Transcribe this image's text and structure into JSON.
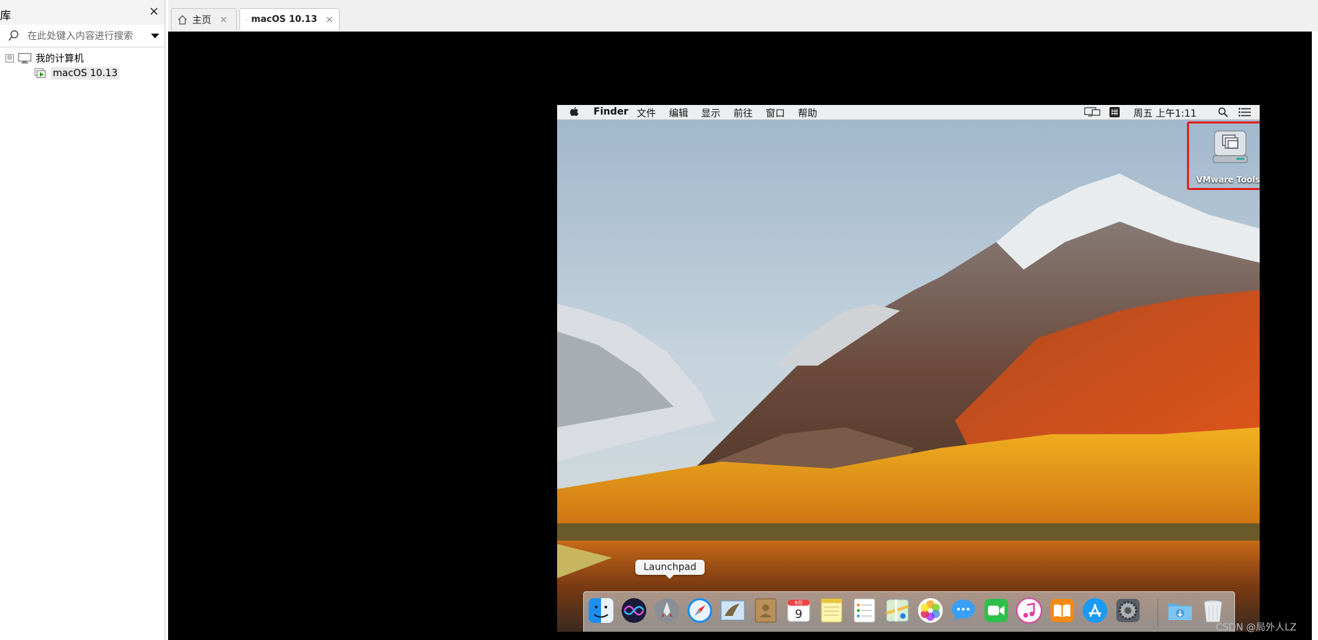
{
  "library": {
    "title": "库",
    "close_icon": "×",
    "search_placeholder": "在此处键入内容进行搜索",
    "tree": [
      {
        "label": "我的计算机",
        "toggle": "⊟"
      },
      {
        "label": "macOS 10.13"
      }
    ]
  },
  "tabs": [
    {
      "label": "主页",
      "close": "×"
    },
    {
      "label": "macOS 10.13",
      "close": "×"
    }
  ],
  "mac": {
    "menubar": {
      "items": [
        "Finder",
        "文件",
        "编辑",
        "显示",
        "前往",
        "窗口",
        "帮助"
      ],
      "clock": "周五 上午1:11"
    },
    "desktop_icon": {
      "label": "VMware Tools",
      "icon": "disk-icon"
    },
    "tooltip": "Launchpad",
    "dock_calendar_month": "6月",
    "dock_calendar_day": "9",
    "dock": [
      {
        "name": "finder-icon"
      },
      {
        "name": "siri-icon"
      },
      {
        "name": "launchpad-icon"
      },
      {
        "name": "safari-icon"
      },
      {
        "name": "mail-icon"
      },
      {
        "name": "contacts-icon"
      },
      {
        "name": "calendar-icon"
      },
      {
        "name": "notes-icon"
      },
      {
        "name": "reminders-icon"
      },
      {
        "name": "maps-icon"
      },
      {
        "name": "photos-icon"
      },
      {
        "name": "messages-icon"
      },
      {
        "name": "facetime-icon"
      },
      {
        "name": "itunes-icon"
      },
      {
        "name": "ibooks-icon"
      },
      {
        "name": "app-store-icon"
      },
      {
        "name": "system-preferences-icon"
      },
      {
        "name": "downloads-folder-icon"
      },
      {
        "name": "trash-icon"
      }
    ]
  },
  "watermark": "CSDN @局外人LZ",
  "colors": {
    "highlight": "#e02020",
    "console_bg": "#000000"
  }
}
